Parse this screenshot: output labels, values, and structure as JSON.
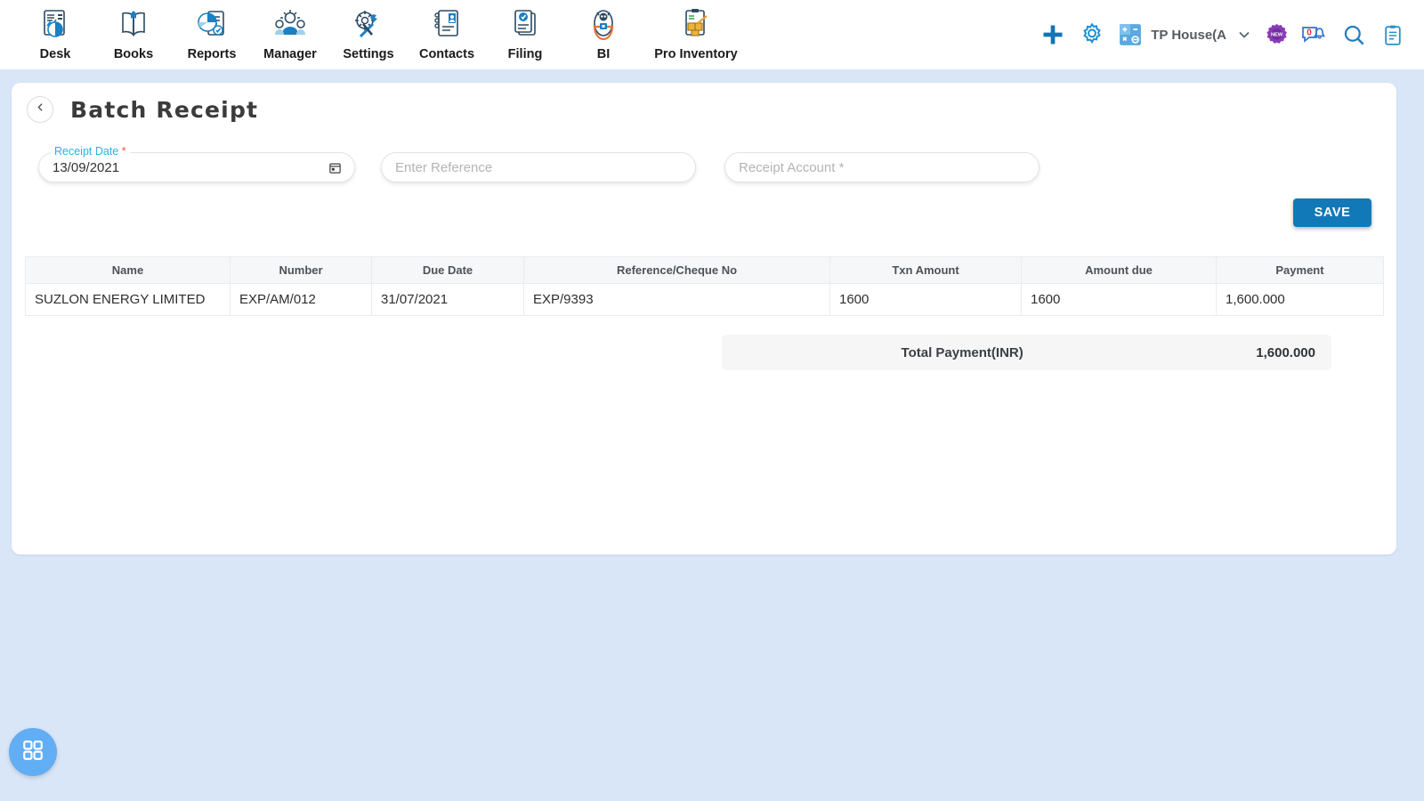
{
  "topnav": {
    "items": [
      {
        "label": "Desk",
        "icon": "desk-icon"
      },
      {
        "label": "Books",
        "icon": "books-icon"
      },
      {
        "label": "Reports",
        "icon": "reports-icon"
      },
      {
        "label": "Manager",
        "icon": "manager-icon"
      },
      {
        "label": "Settings",
        "icon": "settings-icon"
      },
      {
        "label": "Contacts",
        "icon": "contacts-icon"
      },
      {
        "label": "Filing",
        "icon": "filing-icon"
      },
      {
        "label": "BI",
        "icon": "bi-icon"
      },
      {
        "label": "Pro Inventory",
        "icon": "pro-inventory-icon"
      }
    ]
  },
  "actions": {
    "add": "add-icon",
    "settings": "gear-icon",
    "calculator": "calculator-icon",
    "company": "TP House(A",
    "chevron": "chevron-down-icon",
    "new_badge": "new-badge-icon",
    "chat": "chat-bell-icon",
    "chat_count": "0",
    "search": "search-icon",
    "document": "clipboard-icon"
  },
  "page": {
    "title": "Batch Receipt",
    "back": "chevron-left-icon"
  },
  "form": {
    "receipt_date": {
      "label": "Receipt Date",
      "required": "*",
      "value": "13/09/2021",
      "icon": "calendar-icon"
    },
    "reference": {
      "placeholder": "Enter Reference",
      "value": ""
    },
    "receipt_account": {
      "placeholder": "Receipt Account *",
      "value": ""
    },
    "save_label": "SAVE"
  },
  "table": {
    "columns": [
      "Name",
      "Number",
      "Due Date",
      "Reference/Cheque No",
      "Txn Amount",
      "Amount due",
      "Payment"
    ],
    "rows": [
      [
        "SUZLON ENERGY LIMITED",
        "EXP/AM/012",
        "31/07/2021",
        "EXP/9393",
        "1600",
        "1600",
        "1,600.000"
      ]
    ]
  },
  "totals": {
    "label": "Total Payment(INR)",
    "value": "1,600.000"
  },
  "fab": {
    "icon": "grid-apps-icon"
  },
  "colors": {
    "page_bg": "#d9e6f8",
    "card_bg": "#ffffff",
    "accent_blue": "#1279b8",
    "label_blue": "#2ab0e8",
    "required_red": "#e2574c",
    "fab_blue": "#61aef4",
    "header_bg": "#f6f7f8"
  }
}
